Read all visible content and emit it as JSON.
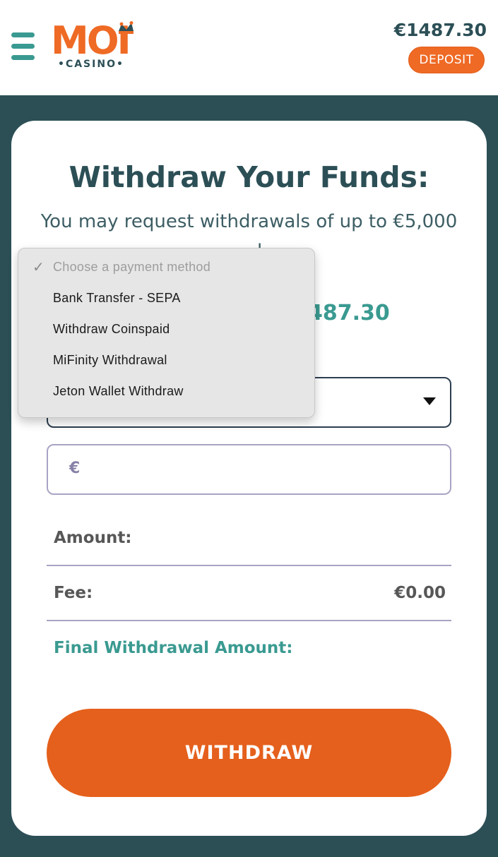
{
  "header": {
    "logo_main": "MOI",
    "logo_sub": "•CASINO•",
    "balance": "€1487.30",
    "deposit_label": "DEPOSIT"
  },
  "card": {
    "title": "Withdraw Your Funds:",
    "subtitle": "You may request withdrawals of up to €5,000",
    "subtitle_tail": "l",
    "available_partial": "487.30",
    "currency_prefix": "€",
    "amount_label": "Amount:",
    "fee_label": "Fee:",
    "fee_value": "€0.00",
    "final_label": "Final Withdrawal Amount:",
    "withdraw_label": "WITHDRAW"
  },
  "dropdown": {
    "options": [
      "Choose a payment method",
      "Bank Transfer - SEPA",
      "Withdraw Coinspaid",
      "MiFinity Withdrawal",
      "Jeton Wallet Withdraw"
    ],
    "selected": "Choose a payment method"
  },
  "colors": {
    "brand_orange": "#ef6a25",
    "teal": "#3a9a91",
    "dark_teal": "#2c4f56"
  }
}
